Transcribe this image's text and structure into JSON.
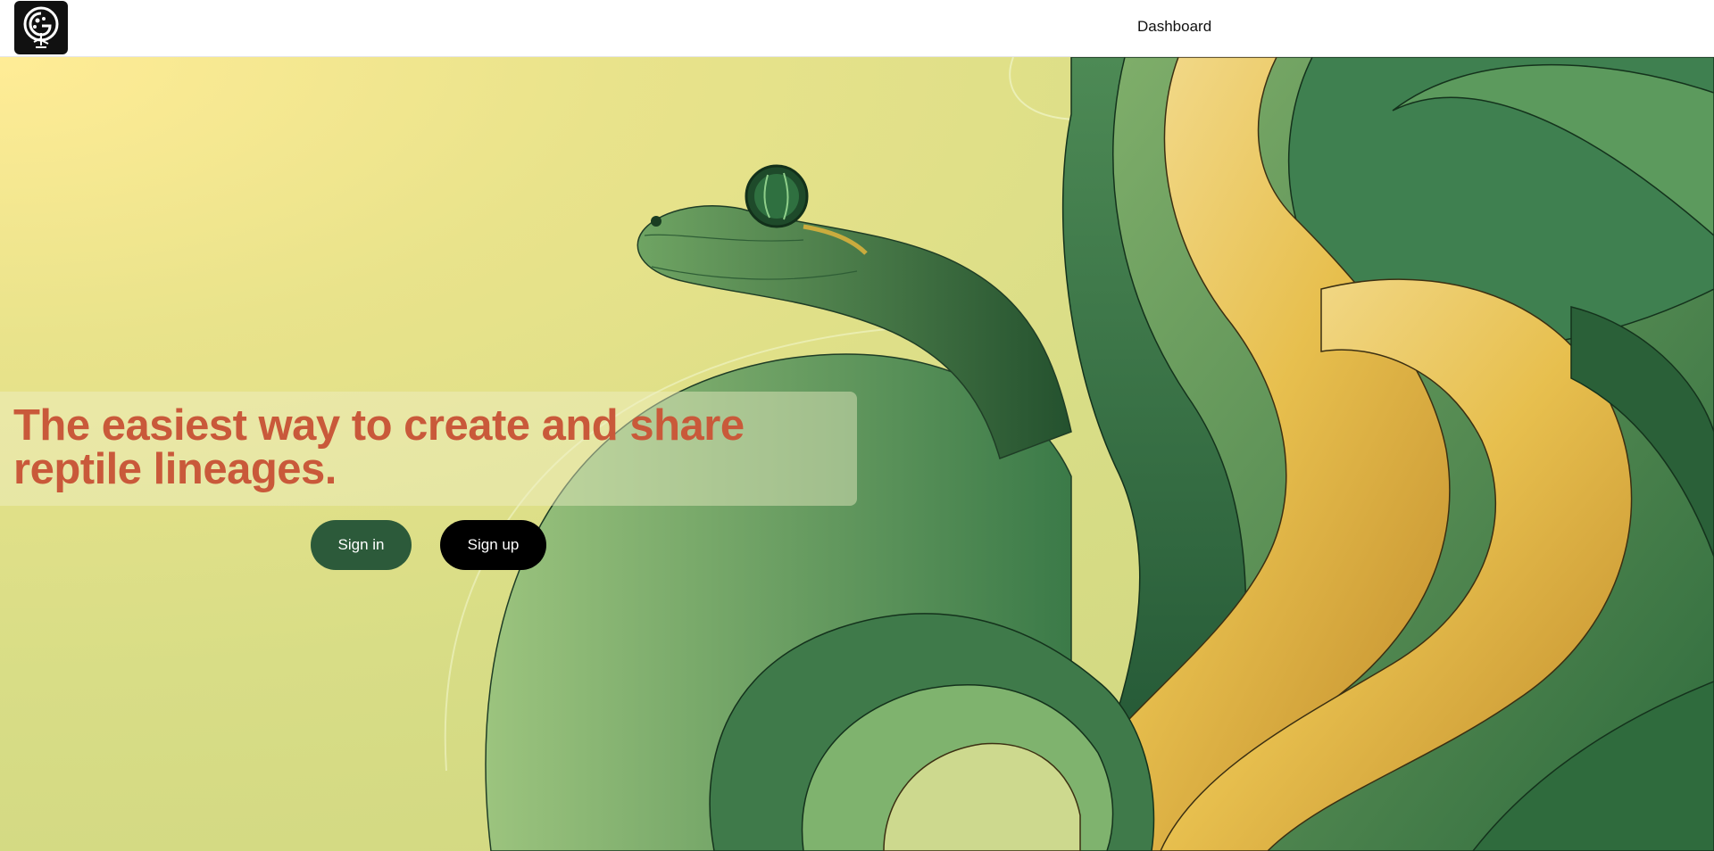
{
  "header": {
    "nav_dashboard": "Dashboard",
    "logo_icon": "tree-g-logo-icon"
  },
  "hero": {
    "headline": "The easiest way to create and share reptile lineages.",
    "headline_color": "#c9593a",
    "sign_in_label": "Sign in",
    "sign_up_label": "Sign up",
    "sign_in_color": "#2c5a3a",
    "sign_up_color": "#000000",
    "illustration": "snake-illustration"
  }
}
